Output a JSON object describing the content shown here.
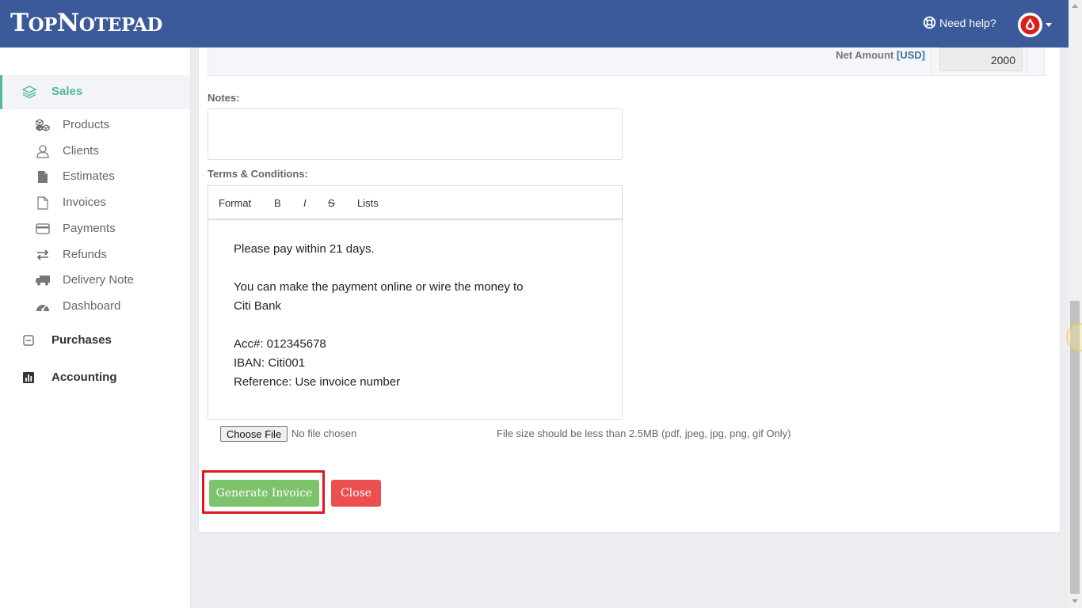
{
  "app": {
    "logo_big1": "T",
    "logo_small1": "OP",
    "logo_big2": "N",
    "logo_small2": "OTEPAD",
    "help_label": "Need help?",
    "accent_color": "#3a5a99"
  },
  "sidebar": {
    "sales_label": "Sales",
    "sub_items": [
      {
        "label": "Products",
        "icon": "boxes-icon"
      },
      {
        "label": "Clients",
        "icon": "user-icon"
      },
      {
        "label": "Estimates",
        "icon": "document-filled-icon"
      },
      {
        "label": "Invoices",
        "icon": "document-outline-icon"
      },
      {
        "label": "Payments",
        "icon": "credit-card-icon"
      },
      {
        "label": "Refunds",
        "icon": "exchange-arrows-icon"
      },
      {
        "label": "Delivery Note",
        "icon": "truck-icon"
      },
      {
        "label": "Dashboard",
        "icon": "gauge-icon"
      }
    ],
    "main_items": [
      {
        "label": "Purchases",
        "icon": "minus-square-icon"
      },
      {
        "label": "Accounting",
        "icon": "bar-chart-icon"
      }
    ]
  },
  "invoice": {
    "net_amount_label": "Net Amount",
    "currency_label": "[USD]",
    "net_amount_value": "2000",
    "notes_label": "Notes:",
    "notes_value": "",
    "terms_label": "Terms & Conditions:",
    "toolbar": {
      "format": "Format",
      "bold": "B",
      "italic": "I",
      "strike": "S",
      "lists": "Lists"
    },
    "terms_lines": [
      "Please pay within 21 days.",
      "",
      "You can make the payment online or wire the money to",
      "Citi Bank",
      "",
      "Acc#: 012345678",
      "IBAN: Citi001",
      "Reference: Use invoice number"
    ],
    "choose_file_label": "Choose File",
    "no_file_label": "No file chosen",
    "file_hint": "File size should be less than 2.5MB (pdf, jpeg, jpg, png, gif Only)",
    "generate_label": "Generate Invoice",
    "close_label": "Close"
  }
}
